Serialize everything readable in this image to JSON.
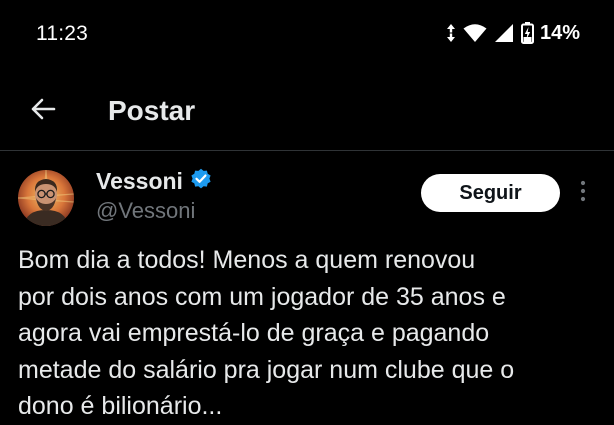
{
  "status_bar": {
    "time": "11:23",
    "battery_percent": "14%",
    "icons": [
      "data-arrows-icon",
      "wifi-icon",
      "signal-icon",
      "battery-charging-icon"
    ]
  },
  "header": {
    "back_icon": "arrow-left-icon",
    "title": "Postar"
  },
  "tweet": {
    "author_name": "Vessoni",
    "verified_icon": "verified-badge-icon",
    "handle": "@Vessoni",
    "follow_label": "Seguir",
    "more_icon": "more-vertical-icon",
    "text": "Bom dia a todos! Menos a quem renovou\npor dois anos com um jogador de 35 anos e\nagora vai emprestá-lo de graça e pagando\nmetade do salário pra jogar num clube que o\ndono é bilionário..."
  },
  "colors": {
    "background": "#000000",
    "text_primary": "#e7e9ea",
    "text_secondary": "#71767b",
    "divider": "#2f3336",
    "verified_blue": "#1d9bf0",
    "follow_button_bg": "#ffffff",
    "follow_button_text": "#0f1419"
  }
}
